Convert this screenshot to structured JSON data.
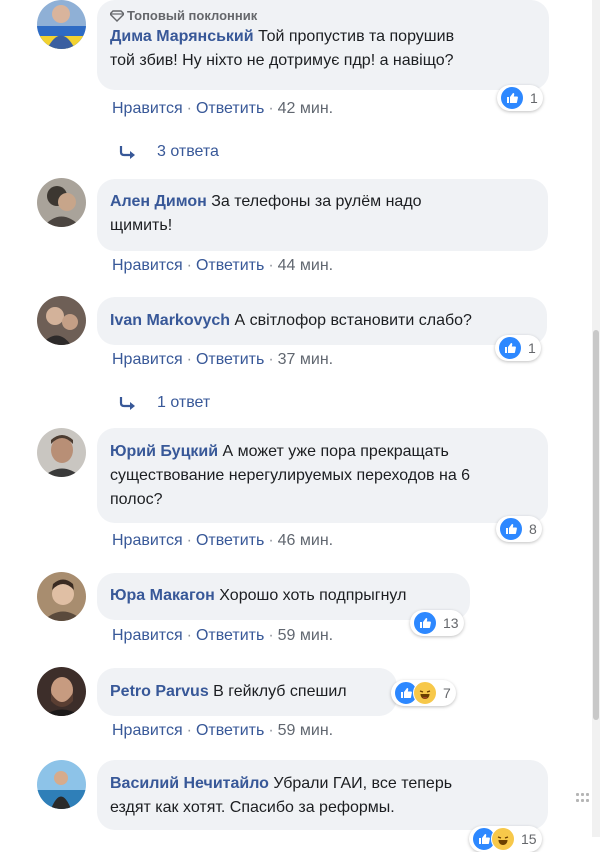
{
  "comments": [
    {
      "badge": "Топовый поклонник",
      "author": "Дима Марянський",
      "text_line1": "Той пропустив та порушив",
      "text_line2": "той збив! Ну ніхто не дотримує пдр! а навіщо?",
      "like": "Нравится",
      "reply": "Ответить",
      "time": "42 мин.",
      "reactions": "1",
      "replies": "3 ответа"
    },
    {
      "author": "Ален Димон",
      "text_line1": "За телефоны за рулём надо",
      "text_line2": "щимить!",
      "like": "Нравится",
      "reply": "Ответить",
      "time": "44 мин."
    },
    {
      "author": "Ivan Markovych",
      "text_line1": "А світлофор встановити слабо?",
      "like": "Нравится",
      "reply": "Ответить",
      "time": "37 мин.",
      "reactions": "1",
      "replies": "1 ответ"
    },
    {
      "author": "Юрий Буцкий",
      "text_line1": "А может уже пора прекращать",
      "text_line2": "существование нерегулируемых переходов на 6",
      "text_line3": "полос?",
      "like": "Нравится",
      "reply": "Ответить",
      "time": "46 мин.",
      "reactions": "8"
    },
    {
      "author": "Юра Макагон",
      "text_line1": "Хорошо хоть подпрыгнул",
      "like": "Нравится",
      "reply": "Ответить",
      "time": "59 мин.",
      "reactions": "13"
    },
    {
      "author": "Petro Parvus",
      "text_line1": "В гейклуб спешил",
      "like": "Нравится",
      "reply": "Ответить",
      "time": "59 мин.",
      "reactions": "7"
    },
    {
      "author": "Василий Нечитайло",
      "text_line1": "Убрали ГАИ, все теперь",
      "text_line2": "ездят как хотят. Спасибо за реформы.",
      "reactions": "15"
    }
  ],
  "icons": {
    "like": "thumbs-up-icon",
    "haha": "laughing-face-icon",
    "reply_arrow": "reply-arrow-icon",
    "badge": "diamond-icon"
  },
  "colors": {
    "name": "#385898",
    "like": "#2d88ff",
    "bubble": "#f0f2f5"
  }
}
